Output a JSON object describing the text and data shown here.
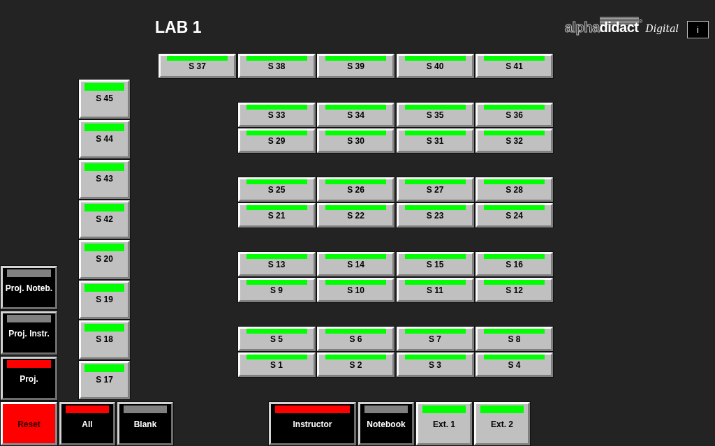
{
  "title": "LAB 1",
  "logo": {
    "text_light": "alpha",
    "text_bold": "didact",
    "registered_mark": "®",
    "tagline": "Digital"
  },
  "info_button": {
    "label": "i"
  },
  "top_row": [
    {
      "label": "S 37",
      "kind": "light",
      "color": "#00ff00"
    },
    {
      "label": "S 38",
      "kind": "light",
      "color": "#00ff00"
    },
    {
      "label": "S 39",
      "kind": "light",
      "color": "#00ff00"
    },
    {
      "label": "S 40",
      "kind": "light",
      "color": "#00ff00"
    },
    {
      "label": "S 41",
      "kind": "light",
      "color": "#00ff00"
    }
  ],
  "side_column": [
    {
      "label": "S 45",
      "kind": "light",
      "color": "#00ff00"
    },
    {
      "label": "S 44",
      "kind": "light",
      "color": "#00ff00"
    },
    {
      "label": "S 43",
      "kind": "light",
      "color": "#00ff00"
    },
    {
      "label": "S 42",
      "kind": "light",
      "color": "#00ff00"
    },
    {
      "label": "S 20",
      "kind": "light",
      "color": "#00ff00"
    },
    {
      "label": "S 19",
      "kind": "light",
      "color": "#00ff00"
    },
    {
      "label": "S 18",
      "kind": "light",
      "color": "#00ff00"
    },
    {
      "label": "S 17",
      "kind": "light",
      "color": "#00ff00"
    }
  ],
  "station_blocks": [
    {
      "rows": [
        [
          {
            "label": "S 33",
            "kind": "light",
            "color": "#00ff00"
          },
          {
            "label": "S 34",
            "kind": "light",
            "color": "#00ff00"
          },
          {
            "label": "S 35",
            "kind": "light",
            "color": "#00ff00"
          },
          {
            "label": "S 36",
            "kind": "light",
            "color": "#00ff00"
          }
        ],
        [
          {
            "label": "S 29",
            "kind": "light",
            "color": "#00ff00"
          },
          {
            "label": "S 30",
            "kind": "light",
            "color": "#00ff00"
          },
          {
            "label": "S 31",
            "kind": "light",
            "color": "#00ff00"
          },
          {
            "label": "S 32",
            "kind": "light",
            "color": "#00ff00"
          }
        ]
      ]
    },
    {
      "rows": [
        [
          {
            "label": "S 25",
            "kind": "light",
            "color": "#00ff00"
          },
          {
            "label": "S 26",
            "kind": "light",
            "color": "#00ff00"
          },
          {
            "label": "S 27",
            "kind": "light",
            "color": "#00ff00"
          },
          {
            "label": "S 28",
            "kind": "light",
            "color": "#00ff00"
          }
        ],
        [
          {
            "label": "S 21",
            "kind": "light",
            "color": "#00ff00"
          },
          {
            "label": "S 22",
            "kind": "light",
            "color": "#00ff00"
          },
          {
            "label": "S 23",
            "kind": "light",
            "color": "#00ff00"
          },
          {
            "label": "S 24",
            "kind": "light",
            "color": "#00ff00"
          }
        ]
      ]
    },
    {
      "rows": [
        [
          {
            "label": "S 13",
            "kind": "light",
            "color": "#00ff00"
          },
          {
            "label": "S 14",
            "kind": "light",
            "color": "#00ff00"
          },
          {
            "label": "S 15",
            "kind": "light",
            "color": "#00ff00"
          },
          {
            "label": "S 16",
            "kind": "light",
            "color": "#00ff00"
          }
        ],
        [
          {
            "label": "S 9",
            "kind": "light",
            "color": "#00ff00"
          },
          {
            "label": "S 10",
            "kind": "light",
            "color": "#00ff00"
          },
          {
            "label": "S 11",
            "kind": "light",
            "color": "#00ff00"
          },
          {
            "label": "S 12",
            "kind": "light",
            "color": "#00ff00"
          }
        ]
      ]
    },
    {
      "rows": [
        [
          {
            "label": "S 5",
            "kind": "light",
            "color": "#00ff00"
          },
          {
            "label": "S 6",
            "kind": "light",
            "color": "#00ff00"
          },
          {
            "label": "S 7",
            "kind": "light",
            "color": "#00ff00"
          },
          {
            "label": "S 8",
            "kind": "light",
            "color": "#00ff00"
          }
        ],
        [
          {
            "label": "S 1",
            "kind": "light",
            "color": "#00ff00"
          },
          {
            "label": "S 2",
            "kind": "light",
            "color": "#00ff00"
          },
          {
            "label": "S 3",
            "kind": "light",
            "color": "#00ff00"
          },
          {
            "label": "S 4",
            "kind": "light",
            "color": "#00ff00"
          }
        ]
      ]
    }
  ],
  "projection_controls": [
    {
      "label": "Proj. Noteb.",
      "kind": "dark",
      "color": "#808080"
    },
    {
      "label": "Proj. Instr.",
      "kind": "dark",
      "color": "#808080"
    },
    {
      "label": "Proj.",
      "kind": "dark",
      "color": "#ff0000"
    }
  ],
  "bottom_left": [
    {
      "label": "Reset",
      "kind": "red"
    },
    {
      "label": "All",
      "kind": "dark",
      "color": "#ff0000"
    },
    {
      "label": "Blank",
      "kind": "dark",
      "color": "#808080"
    }
  ],
  "bottom_right": [
    {
      "label": "Instructor",
      "kind": "dark",
      "color": "#ff0000"
    },
    {
      "label": "Notebook",
      "kind": "dark",
      "color": "#808080"
    },
    {
      "label": "Ext. 1",
      "kind": "light",
      "color": "#00ff00"
    },
    {
      "label": "Ext. 2",
      "kind": "light",
      "color": "#00ff00"
    }
  ]
}
